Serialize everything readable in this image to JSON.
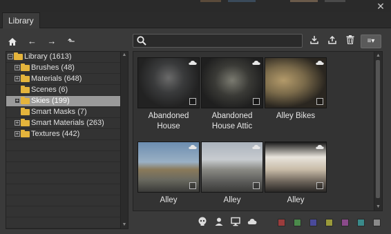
{
  "window": {
    "tab_label": "Library",
    "close_glyph": "✕"
  },
  "toolbar": {
    "home_glyph": "⌂",
    "back_glyph": "←",
    "forward_glyph": "→",
    "up_glyph": "⬑"
  },
  "search": {
    "value": "",
    "placeholder": ""
  },
  "right_tools": {
    "import_glyph": "⤓",
    "export_glyph": "⤒",
    "delete_glyph": "🗑",
    "view_glyph": "≡▾"
  },
  "tree": {
    "items": [
      {
        "label": "Library (1613)",
        "level": 0,
        "expander": "−",
        "selected": false
      },
      {
        "label": "Brushes (48)",
        "level": 1,
        "expander": "+",
        "selected": false
      },
      {
        "label": "Materials (648)",
        "level": 1,
        "expander": "+",
        "selected": false
      },
      {
        "label": "Scenes (6)",
        "level": 1,
        "expander": "",
        "selected": false
      },
      {
        "label": "Skies (199)",
        "level": 1,
        "expander": "+",
        "selected": true
      },
      {
        "label": "Smart Masks (7)",
        "level": 1,
        "expander": "",
        "selected": false
      },
      {
        "label": "Smart Materials (263)",
        "level": 1,
        "expander": "+",
        "selected": false
      },
      {
        "label": "Textures (442)",
        "level": 1,
        "expander": "+",
        "selected": false
      }
    ]
  },
  "assets": [
    {
      "name": "Abandoned House"
    },
    {
      "name": "Abandoned House Attic"
    },
    {
      "name": "Alley Bikes"
    },
    {
      "name": "Alley"
    },
    {
      "name": "Alley"
    },
    {
      "name": "Alley"
    }
  ],
  "bottom": {
    "swatch_colors": [
      "#9b3c3c",
      "#4b8a4b",
      "#4a4a9a",
      "#9a9a3a",
      "#8a4a8a",
      "#3a8a8a",
      "#8a8a8a"
    ]
  }
}
